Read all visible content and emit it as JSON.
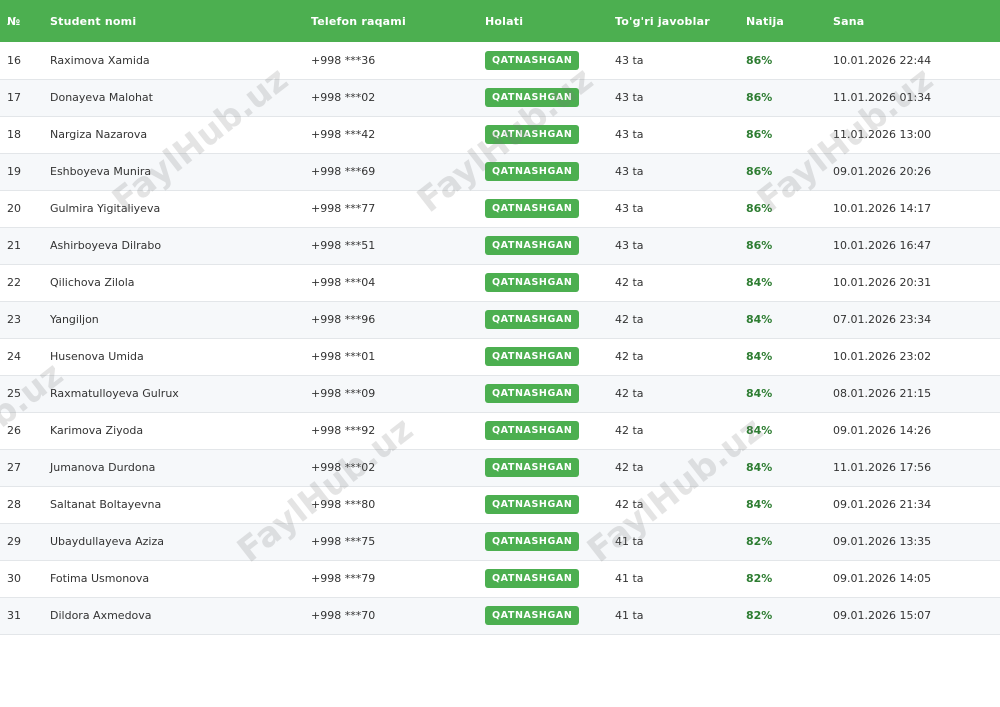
{
  "table": {
    "columns": [
      "№",
      "Student nomi",
      "Telefon raqami",
      "Holati",
      "To'g'ri javoblar",
      "Natija",
      "Sana"
    ],
    "rows": [
      {
        "num": "16",
        "name": "Raximova Xamida",
        "phone": "+998 ***36",
        "status": "QATNASHGAN",
        "correct": "43 ta",
        "result": "86%",
        "date": "10.01.2026 22:44"
      },
      {
        "num": "17",
        "name": "Donayeva Malohat",
        "phone": "+998 ***02",
        "status": "QATNASHGAN",
        "correct": "43 ta",
        "result": "86%",
        "date": "11.01.2026 01:34"
      },
      {
        "num": "18",
        "name": "Nargiza Nazarova",
        "phone": "+998 ***42",
        "status": "QATNASHGAN",
        "correct": "43 ta",
        "result": "86%",
        "date": "11.01.2026 13:00"
      },
      {
        "num": "19",
        "name": "Eshboyeva Munira",
        "phone": "+998 ***69",
        "status": "QATNASHGAN",
        "correct": "43 ta",
        "result": "86%",
        "date": "09.01.2026 20:26"
      },
      {
        "num": "20",
        "name": "Gulmira Yigitaliyeva",
        "phone": "+998 ***77",
        "status": "QATNASHGAN",
        "correct": "43 ta",
        "result": "86%",
        "date": "10.01.2026 14:17"
      },
      {
        "num": "21",
        "name": "Ashirboyeva Dilrabo",
        "phone": "+998 ***51",
        "status": "QATNASHGAN",
        "correct": "43 ta",
        "result": "86%",
        "date": "10.01.2026 16:47"
      },
      {
        "num": "22",
        "name": "Qilichova Zilola",
        "phone": "+998 ***04",
        "status": "QATNASHGAN",
        "correct": "42 ta",
        "result": "84%",
        "date": "10.01.2026 20:31"
      },
      {
        "num": "23",
        "name": "Yangiljon",
        "phone": "+998 ***96",
        "status": "QATNASHGAN",
        "correct": "42 ta",
        "result": "84%",
        "date": "07.01.2026 23:34"
      },
      {
        "num": "24",
        "name": "Husenova Umida",
        "phone": "+998 ***01",
        "status": "QATNASHGAN",
        "correct": "42 ta",
        "result": "84%",
        "date": "10.01.2026 23:02"
      },
      {
        "num": "25",
        "name": "Raxmatulloyeva Gulrux",
        "phone": "+998 ***09",
        "status": "QATNASHGAN",
        "correct": "42 ta",
        "result": "84%",
        "date": "08.01.2026 21:15"
      },
      {
        "num": "26",
        "name": "Karimova Ziyoda",
        "phone": "+998 ***92",
        "status": "QATNASHGAN",
        "correct": "42 ta",
        "result": "84%",
        "date": "09.01.2026 14:26"
      },
      {
        "num": "27",
        "name": "Jumanova Durdona",
        "phone": "+998 ***02",
        "status": "QATNASHGAN",
        "correct": "42 ta",
        "result": "84%",
        "date": "11.01.2026 17:56"
      },
      {
        "num": "28",
        "name": "Saltanat Boltayevna",
        "phone": "+998 ***80",
        "status": "QATNASHGAN",
        "correct": "42 ta",
        "result": "84%",
        "date": "09.01.2026 21:34"
      },
      {
        "num": "29",
        "name": "Ubaydullayeva Aziza",
        "phone": "+998 ***75",
        "status": "QATNASHGAN",
        "correct": "41 ta",
        "result": "82%",
        "date": "09.01.2026 13:35"
      },
      {
        "num": "30",
        "name": "Fotima Usmonova",
        "phone": "+998 ***79",
        "status": "QATNASHGAN",
        "correct": "41 ta",
        "result": "82%",
        "date": "09.01.2026 14:05"
      },
      {
        "num": "31",
        "name": "Dildora Axmedova",
        "phone": "+998 ***70",
        "status": "QATNASHGAN",
        "correct": "41 ta",
        "result": "82%",
        "date": "09.01.2026 15:07"
      }
    ]
  },
  "watermark": {
    "text": "FaylHub.uz"
  },
  "colors": {
    "header_bg": "#4caf50",
    "badge_bg": "#4caf50",
    "result_text": "#2e7d32"
  }
}
